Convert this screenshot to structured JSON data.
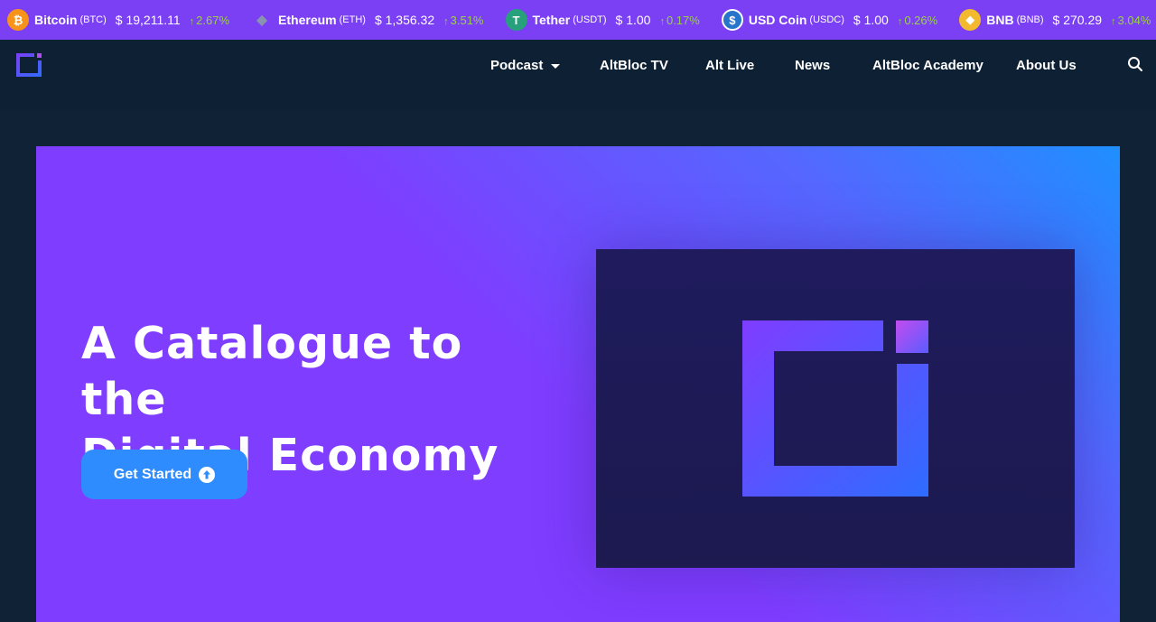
{
  "ticker": [
    {
      "name": "Bitcoin",
      "symbol": "(BTC)",
      "price": "$ 19,211.11",
      "change": "2.67%",
      "icon": "bitcoin-icon",
      "glyph": "₿",
      "color": "#f7931a"
    },
    {
      "name": "Ethereum",
      "symbol": "(ETH)",
      "price": "$ 1,356.32",
      "change": "3.51%",
      "icon": "ethereum-icon",
      "glyph": "◆",
      "color": "#627eea"
    },
    {
      "name": "Tether",
      "symbol": "(USDT)",
      "price": "$ 1.00",
      "change": "0.17%",
      "icon": "tether-icon",
      "glyph": "T",
      "color": "#26a17b"
    },
    {
      "name": "USD Coin",
      "symbol": "(USDC)",
      "price": "$ 1.00",
      "change": "0.26%",
      "icon": "usdc-icon",
      "glyph": "$",
      "color": "#2775ca"
    },
    {
      "name": "BNB",
      "symbol": "(BNB)",
      "price": "$ 270.29",
      "change": "3.04%",
      "icon": "bnb-icon",
      "glyph": "◆",
      "color": "#f3ba2f"
    },
    {
      "name": "",
      "symbol": "",
      "price": "",
      "change": "",
      "icon": "partial-coin-icon",
      "glyph": "◆",
      "color": "#f3ba2f"
    }
  ],
  "nav": {
    "items": [
      "Podcast",
      "AltBloc TV",
      "Alt Live",
      "News",
      "AltBloc Academy",
      "About Us"
    ]
  },
  "hero": {
    "title_line1": "A Catalogue to the",
    "title_line2": "Digital Economy",
    "cta_label": "Get Started"
  },
  "colors": {
    "ticker_bg": "#7b3ff4",
    "nav_bg": "#0e2134",
    "hero_purple": "#7f3dff",
    "hero_blue": "#1f8fff",
    "cta": "#2f8cff",
    "positive": "#9bd14a"
  }
}
